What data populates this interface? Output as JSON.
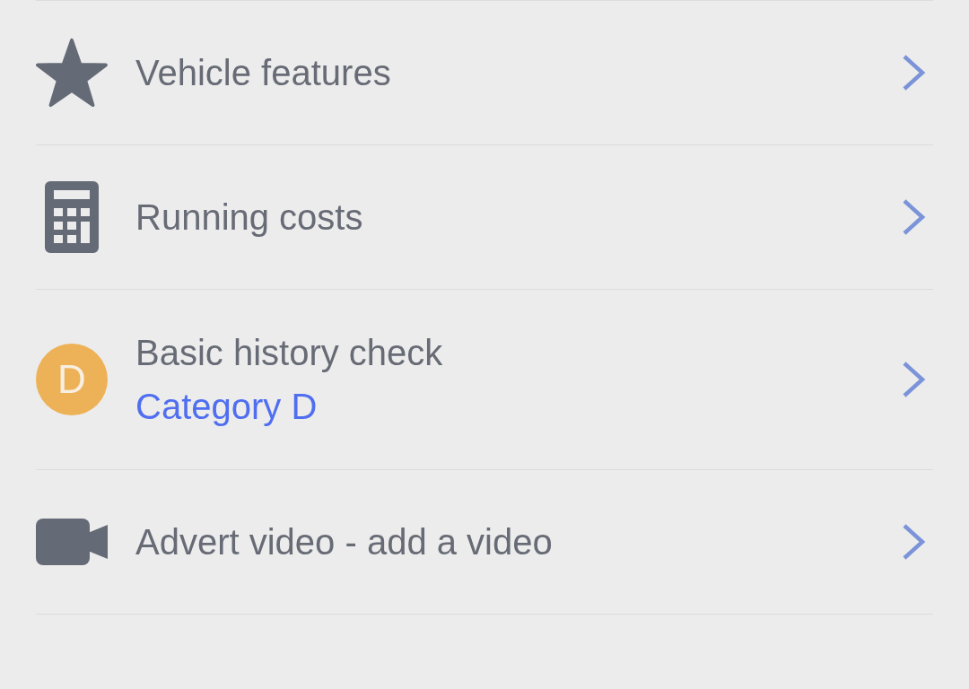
{
  "menu_items": [
    {
      "kind": "icon",
      "title": "Vehicle features"
    },
    {
      "kind": "icon",
      "title": "Running costs"
    },
    {
      "kind": "badge",
      "badge": "D",
      "title": "Basic history check",
      "subtitle": "Category D"
    },
    {
      "kind": "icon",
      "title": "Advert video - add a video"
    }
  ]
}
